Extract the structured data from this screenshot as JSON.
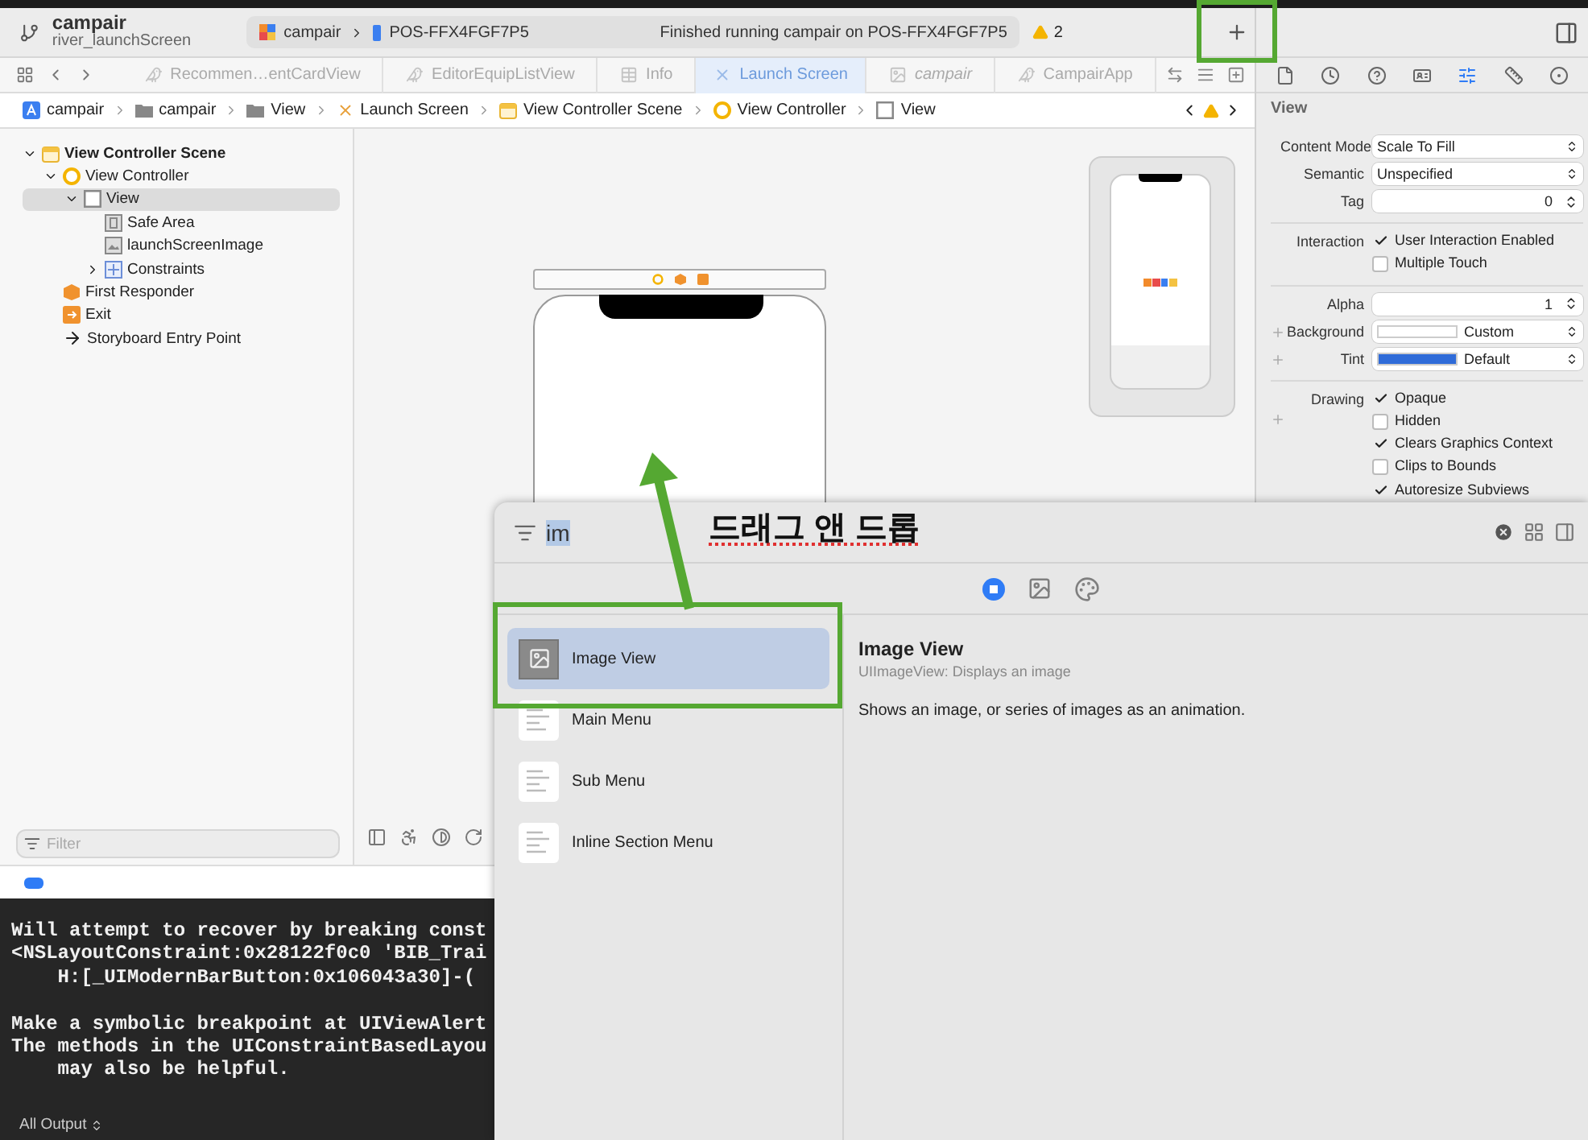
{
  "toolbar": {
    "project": "campair",
    "branch": "river_launchScreen",
    "scheme": "campair",
    "device": "POS-FFX4FGF7P5",
    "status": "Finished running campair on POS-FFX4FGF7P5",
    "warnings": "2"
  },
  "tabs": [
    {
      "label": "Recommen…entCardView",
      "kind": "swift",
      "selected": false,
      "italic": false
    },
    {
      "label": "EditorEquipListView",
      "kind": "swift",
      "selected": false,
      "italic": false
    },
    {
      "label": "Info",
      "kind": "plist",
      "selected": false,
      "italic": false
    },
    {
      "label": "Launch Screen",
      "kind": "storyboard",
      "selected": true,
      "italic": false
    },
    {
      "label": "campair",
      "kind": "asset",
      "selected": false,
      "italic": true
    },
    {
      "label": "CampairApp",
      "kind": "swift",
      "selected": false,
      "italic": false
    }
  ],
  "breadcrumb": [
    {
      "label": "campair",
      "kind": "project"
    },
    {
      "label": "campair",
      "kind": "folder"
    },
    {
      "label": "View",
      "kind": "folder"
    },
    {
      "label": "Launch Screen",
      "kind": "storyboard"
    },
    {
      "label": "View Controller Scene",
      "kind": "scene"
    },
    {
      "label": "View Controller",
      "kind": "controller"
    },
    {
      "label": "View",
      "kind": "view"
    }
  ],
  "navigator": {
    "filter_placeholder": "Filter",
    "tree": [
      {
        "label": "View Controller Scene",
        "kind": "scene",
        "expanded": true,
        "selected": false,
        "children": [
          {
            "label": "View Controller",
            "kind": "controller",
            "expanded": true,
            "selected": false,
            "children": [
              {
                "label": "View",
                "kind": "view",
                "expanded": true,
                "selected": true,
                "children": [
                  {
                    "label": "Safe Area",
                    "kind": "safearea",
                    "selected": false
                  },
                  {
                    "label": "launchScreenImage",
                    "kind": "image",
                    "selected": false
                  },
                  {
                    "label": "Constraints",
                    "kind": "constraints",
                    "expanded": false,
                    "selected": false
                  }
                ]
              }
            ]
          },
          {
            "label": "First Responder",
            "kind": "responder",
            "selected": false
          },
          {
            "label": "Exit",
            "kind": "exit",
            "selected": false
          },
          {
            "label": "Storyboard Entry Point",
            "kind": "entry",
            "selected": false
          }
        ]
      }
    ]
  },
  "inspector": {
    "tabs": [
      {
        "kind": "file",
        "selected": false
      },
      {
        "kind": "history",
        "selected": false
      },
      {
        "kind": "help",
        "selected": false
      },
      {
        "kind": "identity",
        "selected": false
      },
      {
        "kind": "attributes",
        "selected": true
      },
      {
        "kind": "size",
        "selected": false
      },
      {
        "kind": "connections",
        "selected": false
      }
    ],
    "title": "View",
    "sections": [
      [
        {
          "label": "Content Mode",
          "kind": "select",
          "value": "Scale To Fill",
          "addable": false
        },
        {
          "label": "Semantic",
          "kind": "select",
          "value": "Unspecified",
          "addable": false
        },
        {
          "label": "Tag",
          "kind": "stepper",
          "value": "0",
          "addable": false
        }
      ],
      [
        {
          "label": "Interaction",
          "kind": "checks",
          "addable": false,
          "options": [
            {
              "label": "User Interaction Enabled",
              "checked": true
            },
            {
              "label": "Multiple Touch",
              "checked": false
            }
          ]
        }
      ],
      [
        {
          "label": "Alpha",
          "kind": "stepper",
          "value": "1",
          "addable": false
        },
        {
          "label": "Background",
          "kind": "select",
          "value": "Custom",
          "color": "#ffffff",
          "addable": true
        },
        {
          "label": "Tint",
          "kind": "select",
          "value": "Default",
          "color": "#2f6bd8",
          "addable": true
        }
      ],
      [
        {
          "label": "Drawing",
          "kind": "checks",
          "addable": true,
          "options": [
            {
              "label": "Opaque",
              "checked": true
            },
            {
              "label": "Hidden",
              "checked": false
            },
            {
              "label": "Clears Graphics Context",
              "checked": true
            },
            {
              "label": "Clips to Bounds",
              "checked": false
            },
            {
              "label": "Autoresize Subviews",
              "checked": true
            }
          ]
        }
      ]
    ]
  },
  "debug": {
    "breakpoints_on": true
  },
  "console": {
    "blocks": [
      [
        "Will attempt to recover by breaking const",
        "<NSLayoutConstraint:0x28122f0c0 'BIB_Trai",
        "    H:[_UIModernBarButton:0x106043a30]-("
      ],
      [
        "Make a symbolic breakpoint at UIViewAlert",
        "The methods in the UIConstraintBasedLayou",
        "    may also be helpful."
      ]
    ],
    "output_filter": "All Output"
  },
  "library": {
    "search": "im",
    "segments": [
      {
        "kind": "objects",
        "selected": true
      },
      {
        "kind": "media",
        "selected": false
      },
      {
        "kind": "colors",
        "selected": false
      }
    ],
    "items": [
      {
        "label": "Image View",
        "kind": "image",
        "selected": true
      },
      {
        "label": "Main Menu",
        "kind": "menu",
        "selected": false
      },
      {
        "label": "Sub Menu",
        "kind": "menu",
        "selected": false
      },
      {
        "label": "Inline Section Menu",
        "kind": "menu",
        "selected": false
      }
    ],
    "detail": {
      "title": "Image View",
      "subtitle": "UIImageView: Displays an image",
      "description": "Shows an image, or series of images as an animation."
    }
  },
  "annotation": {
    "caption": "드래그 앤 드롭"
  }
}
